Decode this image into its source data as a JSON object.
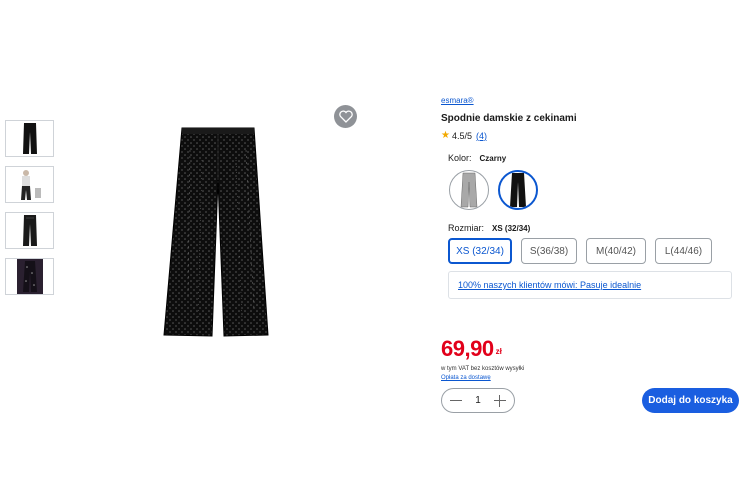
{
  "product": {
    "brand": "esmara®",
    "title": "Spodnie damskie z cekinami",
    "rating": "4.5/5",
    "review_count": "(4)"
  },
  "color": {
    "label": "Kolor:",
    "selected": "Czarny",
    "options": [
      "silver-pants",
      "black-pants"
    ]
  },
  "size": {
    "label": "Rozmiar:",
    "selected": "XS (32/34)",
    "options": [
      "XS (32/34)",
      "S(36/38)",
      "M(40/42)",
      "L(44/46)"
    ]
  },
  "fit_note": "100% naszych klientów mówi: Pasuje idealnie",
  "price": {
    "main": "69,90",
    "currency": "zł",
    "vat_note": "w tym VAT bez kosztów wysyłki",
    "delivery_link": "Opłata za dostawę"
  },
  "quantity": {
    "value": "1"
  },
  "add_to_cart": "Dodaj do koszyka",
  "colors": {
    "accent": "#0b57d0",
    "button": "#1a5ee0",
    "price": "#e2001a",
    "star": "#f2a900"
  }
}
